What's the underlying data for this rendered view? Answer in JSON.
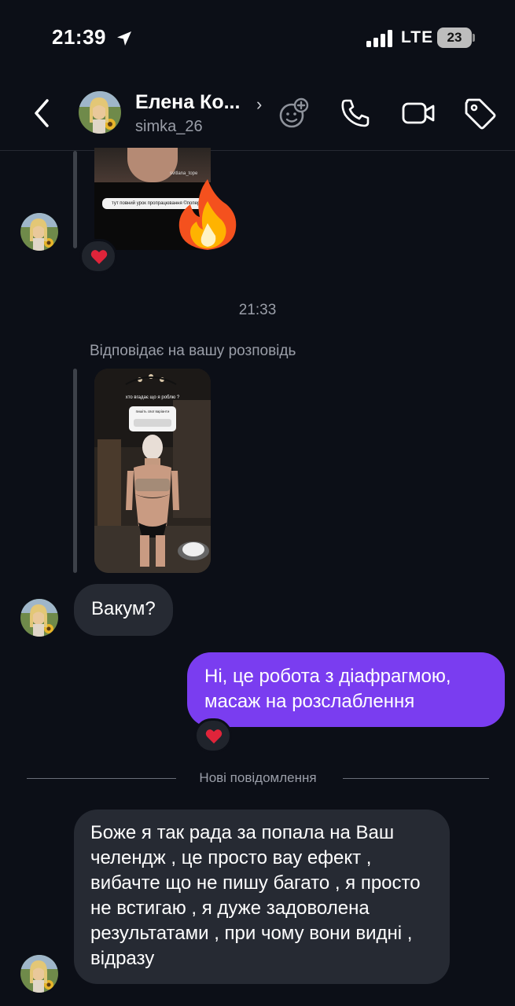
{
  "status_bar": {
    "time": "21:39",
    "carrier": "LTE",
    "battery": "23"
  },
  "header": {
    "name": "Елена Ко...",
    "chevron": "›",
    "username": "simka_26",
    "icons": [
      "back-icon",
      "add-effect-icon",
      "call-icon",
      "video-icon",
      "tag-icon"
    ]
  },
  "conversation": {
    "story_1": {
      "handle": "svitlana_tope",
      "link_text": "тут повний урок пропрацювання ©попереку",
      "sticker": "fire-emoji",
      "reaction": "heart"
    },
    "timestamp": "21:33",
    "reply_caption": "Відповідає на вашу розповідь",
    "story_2": {
      "question": "хто вгадає що я роблю ?",
      "card_text": "пишіть свої варіанти"
    },
    "messages": [
      {
        "from": "contact",
        "text": "Вакум?"
      },
      {
        "from": "me",
        "text": "Ні, це робота з діафрагмою, масаж на розслаблення",
        "reaction": "heart"
      }
    ],
    "new_messages_divider": "Нові повідомлення",
    "new_messages": [
      {
        "from": "contact",
        "text": "Боже я так рада за попала на Ваш челендж , це просто вау ефект , вибачте що не пишу багато , я просто не встигаю , я дуже задоволена результатами , при чому вони видні , відразу"
      }
    ]
  },
  "colors": {
    "background": "#0c0f17",
    "incoming_bubble": "#262a33",
    "outgoing_bubble": "#7a3df0",
    "secondary_text": "#9a9ea8",
    "heart": "#e0243a"
  }
}
